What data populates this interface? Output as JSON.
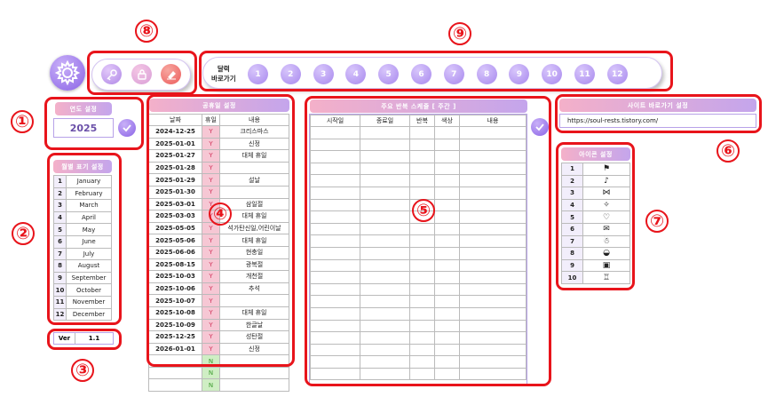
{
  "annotations": [
    "①",
    "②",
    "③",
    "④",
    "⑤",
    "⑥",
    "⑦",
    "⑧",
    "⑨"
  ],
  "toolbar": {
    "icons": [
      "settings-icon",
      "key-icon",
      "lock-icon",
      "eraser-icon"
    ],
    "nav_label_line1": "달력",
    "nav_label_line2": "바로가기",
    "months": [
      "1",
      "2",
      "3",
      "4",
      "5",
      "6",
      "7",
      "8",
      "9",
      "10",
      "11",
      "12"
    ]
  },
  "year_setting": {
    "title": "연도 설정",
    "value": "2025"
  },
  "month_display": {
    "title": "월별 표기 설정",
    "rows": [
      {
        "n": "1",
        "name": "January"
      },
      {
        "n": "2",
        "name": "February"
      },
      {
        "n": "3",
        "name": "March"
      },
      {
        "n": "4",
        "name": "April"
      },
      {
        "n": "5",
        "name": "May"
      },
      {
        "n": "6",
        "name": "June"
      },
      {
        "n": "7",
        "name": "July"
      },
      {
        "n": "8",
        "name": "August"
      },
      {
        "n": "9",
        "name": "September"
      },
      {
        "n": "10",
        "name": "October"
      },
      {
        "n": "11",
        "name": "November"
      },
      {
        "n": "12",
        "name": "December"
      }
    ]
  },
  "version": {
    "label": "Ver",
    "value": "1.1"
  },
  "holidays": {
    "title": "공휴일 설정",
    "headers": [
      "날짜",
      "휴일",
      "내용"
    ],
    "rows": [
      {
        "date": "2024-12-25",
        "flag": "Y",
        "desc": "크리스마스"
      },
      {
        "date": "2025-01-01",
        "flag": "Y",
        "desc": "신정"
      },
      {
        "date": "2025-01-27",
        "flag": "Y",
        "desc": "대체 휴일"
      },
      {
        "date": "2025-01-28",
        "flag": "Y",
        "desc": ""
      },
      {
        "date": "2025-01-29",
        "flag": "Y",
        "desc": "설날"
      },
      {
        "date": "2025-01-30",
        "flag": "Y",
        "desc": ""
      },
      {
        "date": "2025-03-01",
        "flag": "Y",
        "desc": "삼일절"
      },
      {
        "date": "2025-03-03",
        "flag": "Y",
        "desc": "대체 휴일"
      },
      {
        "date": "2025-05-05",
        "flag": "Y",
        "desc": "석가탄신일,어린이날"
      },
      {
        "date": "2025-05-06",
        "flag": "Y",
        "desc": "대체 휴일"
      },
      {
        "date": "2025-06-06",
        "flag": "Y",
        "desc": "현충일"
      },
      {
        "date": "2025-08-15",
        "flag": "Y",
        "desc": "광복절"
      },
      {
        "date": "2025-10-03",
        "flag": "Y",
        "desc": "개천절"
      },
      {
        "date": "2025-10-06",
        "flag": "Y",
        "desc": "추석"
      },
      {
        "date": "2025-10-07",
        "flag": "Y",
        "desc": ""
      },
      {
        "date": "2025-10-08",
        "flag": "Y",
        "desc": "대체 휴일"
      },
      {
        "date": "2025-10-09",
        "flag": "Y",
        "desc": "한글날"
      },
      {
        "date": "2025-12-25",
        "flag": "Y",
        "desc": "성탄절"
      },
      {
        "date": "2026-01-01",
        "flag": "Y",
        "desc": "신정"
      },
      {
        "date": "",
        "flag": "N",
        "desc": ""
      },
      {
        "date": "",
        "flag": "N",
        "desc": ""
      },
      {
        "date": "",
        "flag": "N",
        "desc": ""
      }
    ]
  },
  "schedule": {
    "title": "주요 반복 스케줄 [ 주간 ]",
    "headers": [
      "시작일",
      "종료일",
      "반복",
      "색상",
      "내용"
    ]
  },
  "site_shortcut": {
    "title": "사이트 바로가기 설정",
    "url": "https://soul-rests.tistory.com/"
  },
  "icon_setting": {
    "title": "아이콘 설정",
    "rows": [
      {
        "n": "1",
        "icon": "flag-icon",
        "glyph": "⚑"
      },
      {
        "n": "2",
        "icon": "bell-icon",
        "glyph": "♪"
      },
      {
        "n": "3",
        "icon": "bow-icon",
        "glyph": "⋈"
      },
      {
        "n": "4",
        "icon": "sparkle-icon",
        "glyph": "✧"
      },
      {
        "n": "5",
        "icon": "heart-icon",
        "glyph": "♡"
      },
      {
        "n": "6",
        "icon": "mail-icon",
        "glyph": "✉"
      },
      {
        "n": "7",
        "icon": "person-icon",
        "glyph": "☃"
      },
      {
        "n": "8",
        "icon": "bowl-icon",
        "glyph": "◒"
      },
      {
        "n": "9",
        "icon": "gift-icon",
        "glyph": "▣"
      },
      {
        "n": "10",
        "icon": "trophy-icon",
        "glyph": "♖"
      }
    ]
  },
  "colors": {
    "accent": "#a889ee",
    "red_annotation": "#e8141b",
    "flag_yes": "#f6c7d4",
    "flag_no": "#cfeec4"
  }
}
